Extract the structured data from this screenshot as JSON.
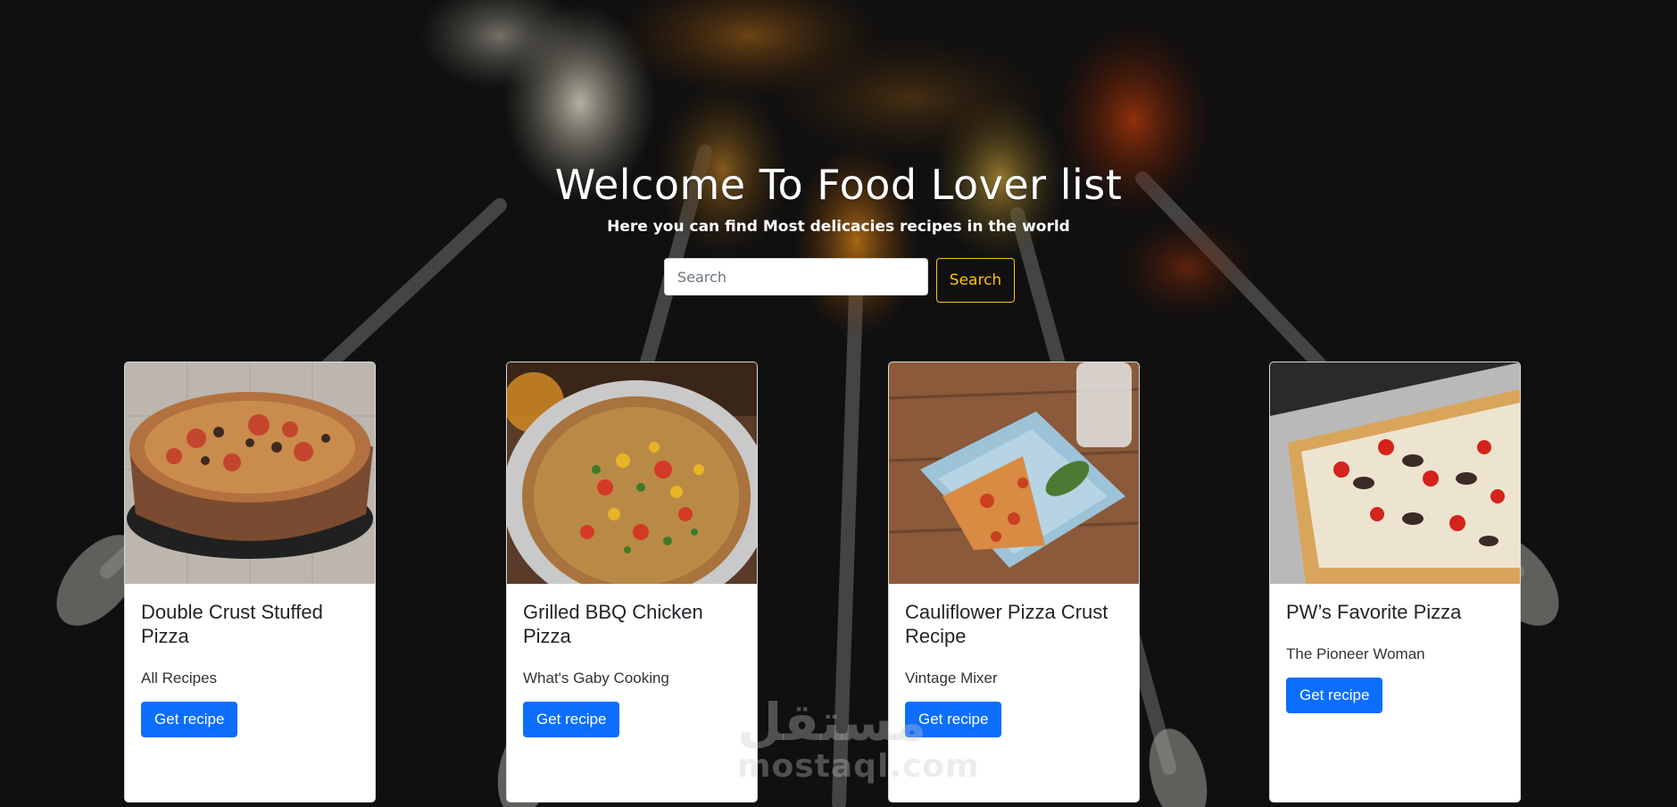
{
  "hero": {
    "title": "Welcome To Food Lover list",
    "subtitle": "Here you can find Most delicacies recipes in the world"
  },
  "search": {
    "placeholder": "Search",
    "value": "",
    "button_label": "Search"
  },
  "cards": [
    {
      "title": "Double Crust Stuffed Pizza",
      "source": "All Recipes",
      "button_label": "Get recipe",
      "image_icon": "pizza-photo"
    },
    {
      "title": "Grilled BBQ Chicken Pizza",
      "source": "What's Gaby Cooking",
      "button_label": "Get recipe",
      "image_icon": "pizza-photo"
    },
    {
      "title": "Cauliflower Pizza Crust Recipe",
      "source": "Vintage Mixer",
      "button_label": "Get recipe",
      "image_icon": "pizza-photo"
    },
    {
      "title": "PW’s Favorite Pizza",
      "source": "The Pioneer Woman",
      "button_label": "Get recipe",
      "image_icon": "pizza-photo"
    }
  ],
  "watermark": {
    "arabic": "مستقل",
    "latin": "mostaql.com"
  },
  "colors": {
    "accent": "#ffc107",
    "primary": "#0d6efd",
    "background": "#141414"
  }
}
